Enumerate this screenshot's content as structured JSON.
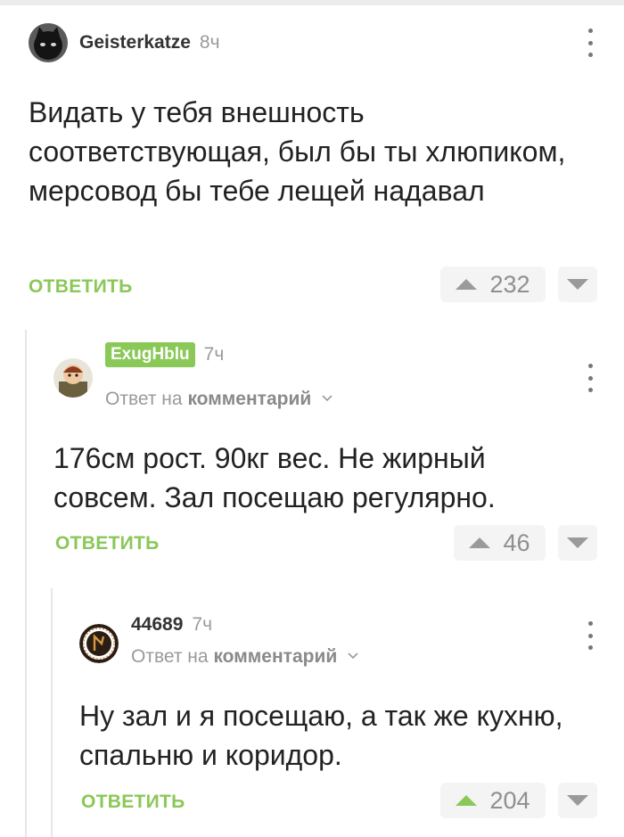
{
  "comments": [
    {
      "username": "Geisterkatze",
      "time": "8ч",
      "text": "Видать у тебя внешность соответствующая, был бы ты хлюпиком, мерсовод бы тебе лещей надавал",
      "reply_label": "ОТВЕТИТЬ",
      "rating": "232",
      "avatar_icon": "black-cat-avatar"
    },
    {
      "username": "ExugHblu",
      "time": "7ч",
      "reply_to_prefix": "Ответ на",
      "reply_to_target": "комментарий",
      "text": "176см рост. 90кг вес. Не жирный совсем. Зал посещаю регулярно.",
      "reply_label": "ОТВЕТИТЬ",
      "rating": "46",
      "avatar_icon": "cartoon-character-avatar"
    },
    {
      "username": "44689",
      "time": "7ч",
      "reply_to_prefix": "Ответ на",
      "reply_to_target": "комментарий",
      "text": "Ну зал и я посещаю, а так же кухню, спальню и коридор.",
      "reply_label": "ОТВЕТИТЬ",
      "rating": "204",
      "avatar_icon": "rune-emblem-avatar"
    }
  ],
  "colors": {
    "accent": "#8ac858",
    "username_badge": "#8ac858",
    "upvote_active": "#8ac858",
    "muted": "#9a9a9a",
    "vote_bg": "#f4f4f4"
  }
}
